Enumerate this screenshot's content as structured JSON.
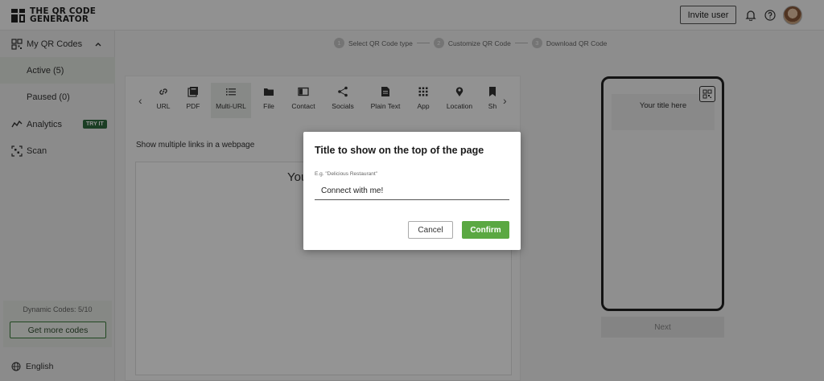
{
  "header": {
    "logo_line1": "THE QR CODE",
    "logo_line2": "GENERATOR",
    "invite_label": "Invite user",
    "icons": [
      "bell-icon",
      "help-icon"
    ]
  },
  "sidebar": {
    "items": [
      {
        "label": "My QR Codes",
        "icon": "grid-icon"
      },
      {
        "label": "Active (5)"
      },
      {
        "label": "Paused (0)"
      },
      {
        "label": "Analytics",
        "icon": "analytics-icon",
        "badge": "TRY IT"
      },
      {
        "label": "Scan",
        "icon": "scan-icon"
      }
    ],
    "dynamic_codes": "Dynamic Codes: 5/10",
    "more_codes_label": "Get more codes",
    "language": "English"
  },
  "steps": [
    {
      "num": "1",
      "label": "Select QR Code type"
    },
    {
      "num": "2",
      "label": "Customize QR Code"
    },
    {
      "num": "3",
      "label": "Download QR Code"
    }
  ],
  "types": [
    {
      "label": "URL",
      "icon": "link-icon"
    },
    {
      "label": "PDF",
      "icon": "pdf-icon"
    },
    {
      "label": "Multi-URL",
      "icon": "list-icon"
    },
    {
      "label": "File",
      "icon": "folder-icon"
    },
    {
      "label": "Contact",
      "icon": "contact-icon"
    },
    {
      "label": "Socials",
      "icon": "share-icon"
    },
    {
      "label": "Plain Text",
      "icon": "text-icon"
    },
    {
      "label": "App",
      "icon": "apps-icon"
    },
    {
      "label": "Location",
      "icon": "pin-icon"
    },
    {
      "label": "Sh",
      "icon": "bookmark-icon"
    }
  ],
  "main": {
    "description": "Show multiple links in a webpage",
    "inner_title_fragment": "You"
  },
  "preview": {
    "title": "Your title here",
    "next_label": "Next"
  },
  "modal": {
    "title": "Title to show on the top of the page",
    "placeholder": "E.g. \"Delicious Restaurant\"",
    "value": "Connect with me!",
    "cancel_label": "Cancel",
    "confirm_label": "Confirm"
  },
  "colors": {
    "accent_green": "#5aa842",
    "badge_green": "#2f6b3e",
    "overlay": "rgba(0,0,0,0.42)"
  }
}
